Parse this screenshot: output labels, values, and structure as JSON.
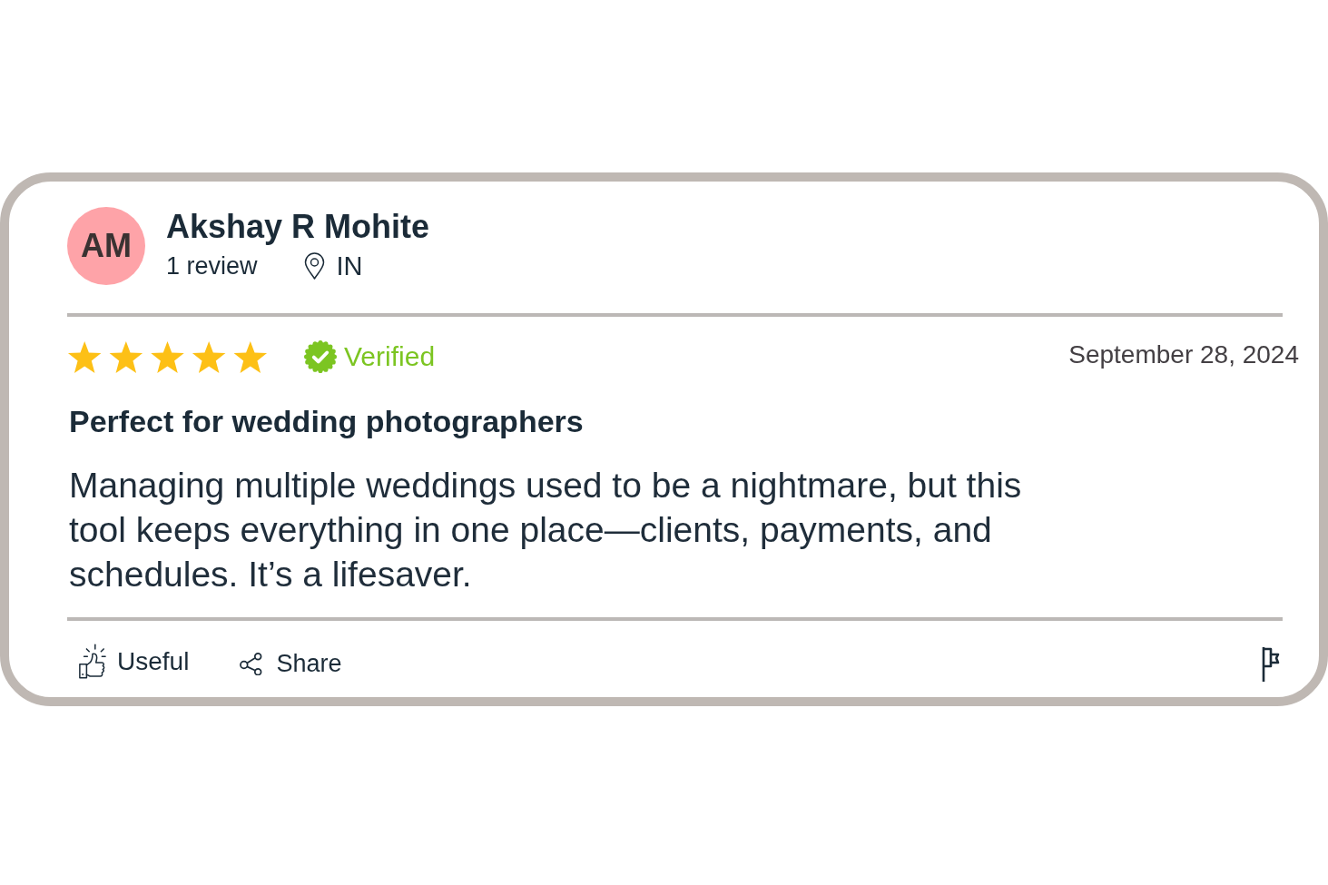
{
  "reviewer": {
    "initials": "AM",
    "name": "Akshay R Mohite",
    "review_count": "1 review",
    "country": "IN"
  },
  "review": {
    "stars": 5,
    "verified": true,
    "verified_label": "Verified",
    "date": "September 28, 2024",
    "title": "Perfect for wedding photographers",
    "body": "Managing multiple weddings used to be a nightmare, but this tool keeps everything in one place—clients, payments, and schedules. It’s a lifesaver."
  },
  "actions": [
    {
      "kind": "useful",
      "label": "Useful"
    },
    {
      "kind": "share",
      "label": "Share"
    },
    {
      "kind": "flag"
    }
  ]
}
